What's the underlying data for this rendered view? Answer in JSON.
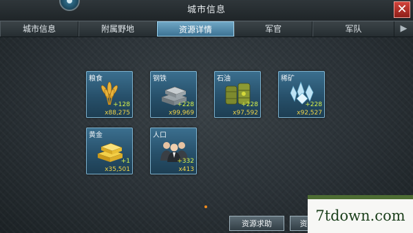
{
  "window": {
    "title": "城市信息",
    "close_symbol": "✕"
  },
  "tabs": [
    {
      "label": "城市信息",
      "active": false
    },
    {
      "label": "附属野地",
      "active": false
    },
    {
      "label": "资源详情",
      "active": true
    },
    {
      "label": "军官",
      "active": false
    },
    {
      "label": "军队",
      "active": false
    }
  ],
  "tab_more_symbol": "▶",
  "resources": [
    {
      "name": "粮食",
      "rate": "+128",
      "total": "x88,275",
      "icon": "wheat-icon"
    },
    {
      "name": "钢铁",
      "rate": "+228",
      "total": "x99,969",
      "icon": "steel-ingots-icon"
    },
    {
      "name": "石油",
      "rate": "+228",
      "total": "x97,592",
      "icon": "oil-barrels-icon"
    },
    {
      "name": "稀矿",
      "rate": "+228",
      "total": "x92,527",
      "icon": "crystal-icon"
    },
    {
      "name": "黄金",
      "rate": "+1",
      "total": "x35,501",
      "icon": "gold-bars-icon"
    },
    {
      "name": "人口",
      "rate": "+332",
      "total": "x413",
      "icon": "population-icon"
    }
  ],
  "buttons": {
    "request_help": "资源求助",
    "second": "资"
  },
  "watermark": {
    "text": "7tdown.com"
  },
  "colors": {
    "accent": "#3d7394",
    "rate": "#d8f24a",
    "total": "#f1d447",
    "close": "#c0392b"
  }
}
